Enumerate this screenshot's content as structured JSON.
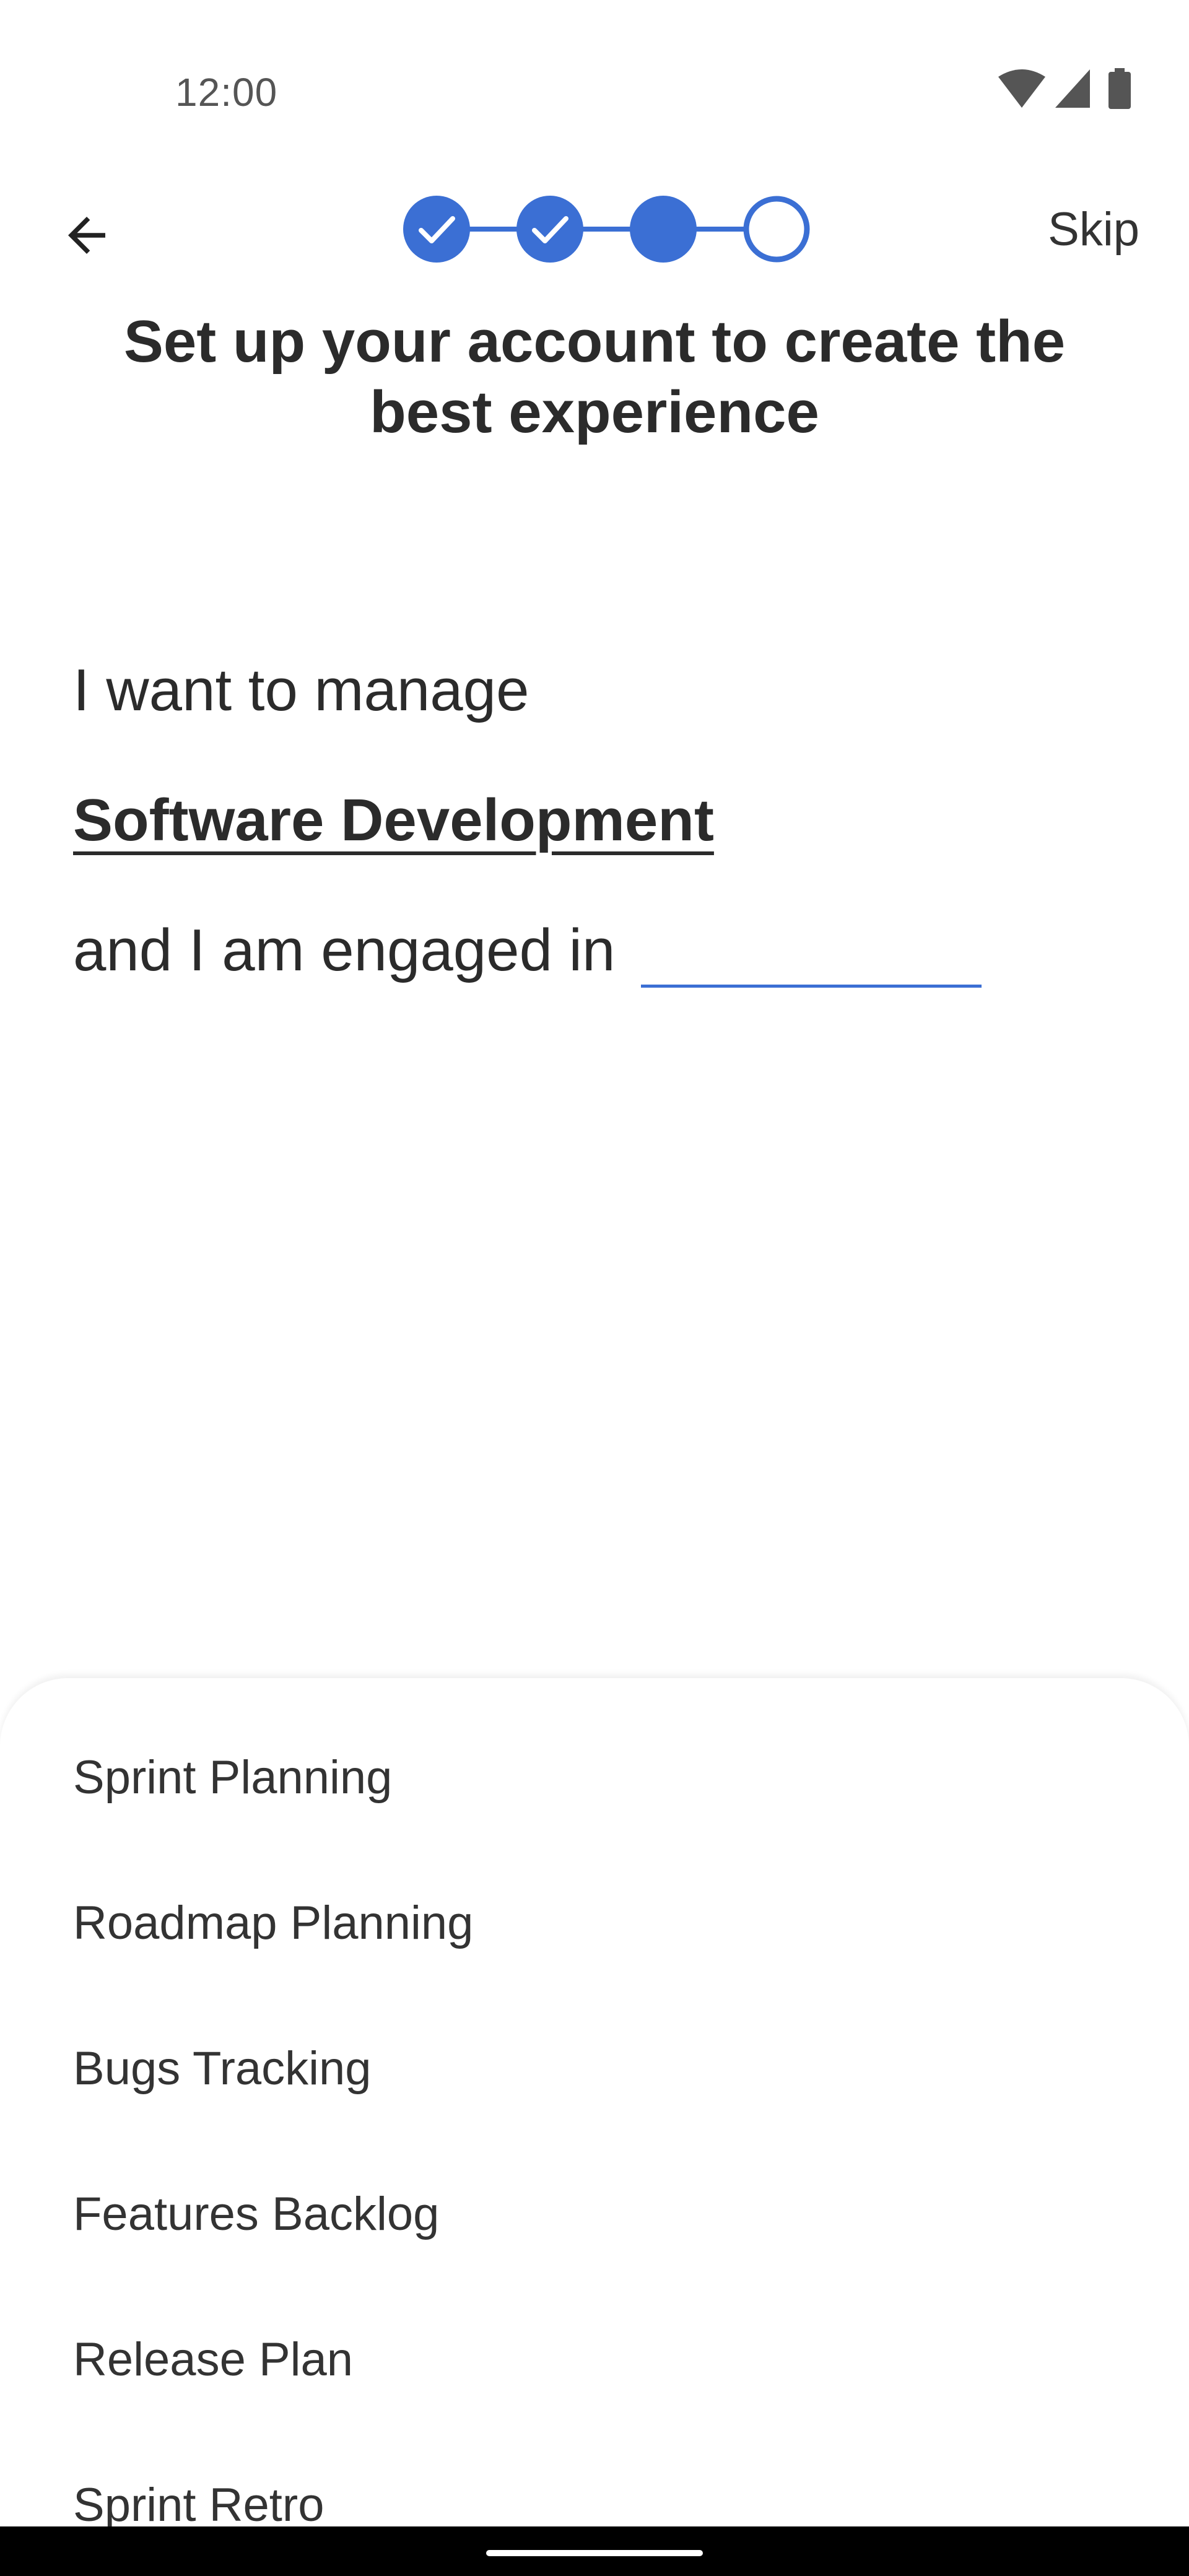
{
  "status_bar": {
    "time": "12:00",
    "icons": [
      "wifi-icon",
      "cellular-signal-icon",
      "battery-icon"
    ]
  },
  "top_bar": {
    "back_icon": "arrow-left-icon",
    "skip_label": "Skip",
    "stepper": {
      "total_steps": 4,
      "completed_steps": 2,
      "current_step": 3,
      "accent_color": "#3B6FD4"
    }
  },
  "title": "Set up your account to create the best experience",
  "sentence": {
    "line1": "I want to manage",
    "selected_category": "Software Development",
    "line3": "and I am engaged in",
    "blank_value": ""
  },
  "options": [
    "Sprint Planning",
    "Roadmap Planning",
    "Bugs Tracking",
    "Features Backlog",
    "Release Plan",
    "Sprint Retro"
  ]
}
